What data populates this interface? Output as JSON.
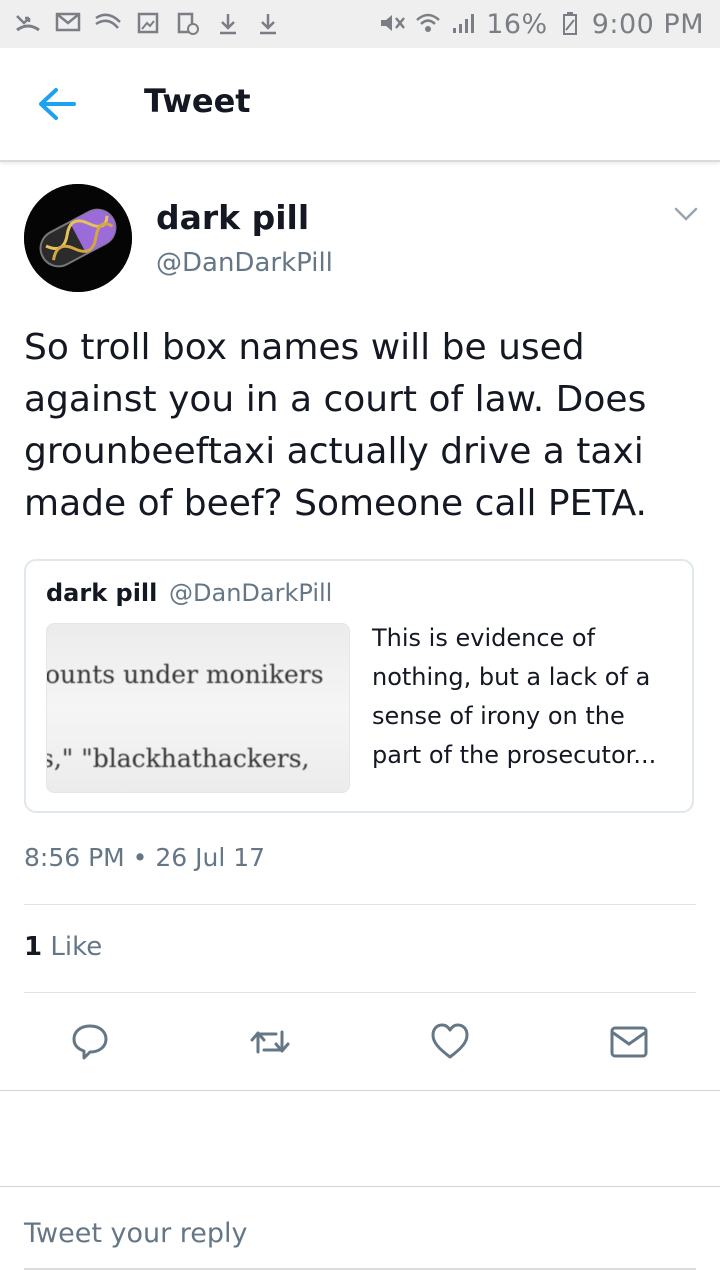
{
  "status_bar": {
    "battery": "16%",
    "time": "9:00 PM",
    "left_icons": [
      "missed-call-icon",
      "mail-icon",
      "swipe-icon",
      "image-icon",
      "screenshot-icon",
      "download-icon",
      "download-icon"
    ],
    "right_icons": [
      "mute-icon",
      "wifi-icon",
      "signal-icon",
      "battery-icon"
    ]
  },
  "header": {
    "title": "Tweet"
  },
  "tweet": {
    "author_name": "dark pill",
    "author_handle": "@DanDarkPill",
    "text": "So troll box names will be used against you in a court of law. Does grounbeeftaxi actually drive a taxi made of beef? Someone call PETA.",
    "timestamp": "8:56 PM • 26 Jul 17",
    "likes_count": "1",
    "likes_label": "Like"
  },
  "quoted": {
    "author_name": "dark pill",
    "author_handle": "@DanDarkPill",
    "image_line_1": "ounts under monikers",
    "image_line_2": "s,\" \"blackhathackers,",
    "text": "This is evidence of nothing, but a lack of a sense of irony on the part of the prosecutor..."
  },
  "reply": {
    "placeholder": "Tweet your reply"
  },
  "colors": {
    "accent": "#1da1f2",
    "secondary_text": "#657786",
    "icon_gray": "#657786"
  }
}
